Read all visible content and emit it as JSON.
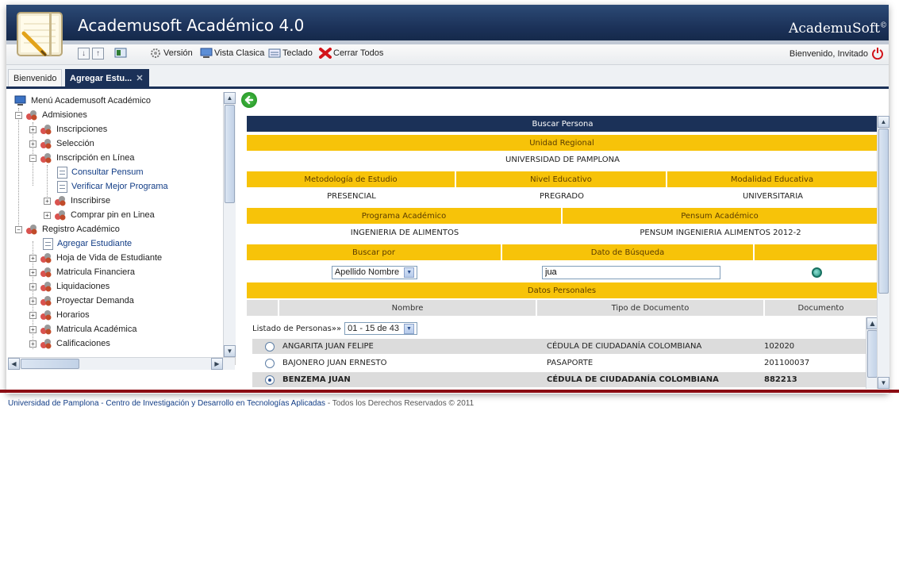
{
  "header": {
    "title": "Academusoft Académico 4.0",
    "brand": "AcademuSoft",
    "brand_mark": "©"
  },
  "toolbar": {
    "version": "Versión",
    "vista": "Vista Clasica",
    "teclado": "Teclado",
    "cerrar": "Cerrar Todos",
    "welcome": "Bienvenido, Invitado"
  },
  "tabs": [
    {
      "label": "Bienvenido"
    },
    {
      "label": "Agregar Estu..."
    }
  ],
  "tree": {
    "root": "Menú Academusoft Académico",
    "items": [
      "Admisiones",
      "Inscripciones",
      "Selección",
      "Inscripción en Línea",
      "Consultar Pensum",
      "Verificar Mejor Programa",
      "Inscribirse",
      "Comprar pin en Linea",
      "Registro Académico",
      "Agregar Estudiante",
      "Hoja de Vida de Estudiante",
      "Matricula Financiera",
      "Liquidaciones",
      "Proyectar Demanda",
      "Horarios",
      "Matricula Académica",
      "Calificaciones"
    ]
  },
  "form": {
    "section_title": "Buscar Persona",
    "unidad_label": "Unidad Regional",
    "unidad_value": "UNIVERSIDAD DE PAMPLONA",
    "metodologia_label": "Metodología de Estudio",
    "nivel_label": "Nivel Educativo",
    "modalidad_label": "Modalidad Educativa",
    "metodologia_value": "PRESENCIAL",
    "nivel_value": "PREGRADO",
    "modalidad_value": "UNIVERSITARIA",
    "programa_label": "Programa Académico",
    "pensum_label": "Pensum Académico",
    "programa_value": "INGENIERIA DE ALIMENTOS",
    "pensum_value": "PENSUM INGENIERIA ALIMENTOS 2012-2",
    "buscar_por_label": "Buscar por",
    "dato_label": "Dato de Búsqueda",
    "buscar_por_value": "Apellido Nombre",
    "dato_value": "jua",
    "datos_personales": "Datos Personales",
    "col_nombre": "Nombre",
    "col_tipo": "Tipo de Documento",
    "col_documento": "Documento",
    "listado_label": "Listado de Personas»»",
    "listado_range": "01 - 15 de 43"
  },
  "people": [
    {
      "nombre": "ANGARITA JUAN FELIPE",
      "tipo": "CÉDULA DE CIUDADANÍA COLOMBIANA",
      "documento": "102020",
      "selected": false
    },
    {
      "nombre": "BAJONERO JUAN ERNESTO",
      "tipo": "PASAPORTE",
      "documento": "201100037",
      "selected": false
    },
    {
      "nombre": "BENZEMA JUAN",
      "tipo": "CÉDULA DE CIUDADANÍA COLOMBIANA",
      "documento": "882213",
      "selected": true
    }
  ],
  "footer": {
    "link": "Universidad de Pamplona - Centro de Investigación y Desarrollo en Tecnologías Aplicadas",
    "rights": " - Todos los Derechos Reservados © 2011"
  },
  "colors": {
    "navy": "#1b3158",
    "yellow": "#f7c309",
    "footer_red": "#8b0d14"
  }
}
